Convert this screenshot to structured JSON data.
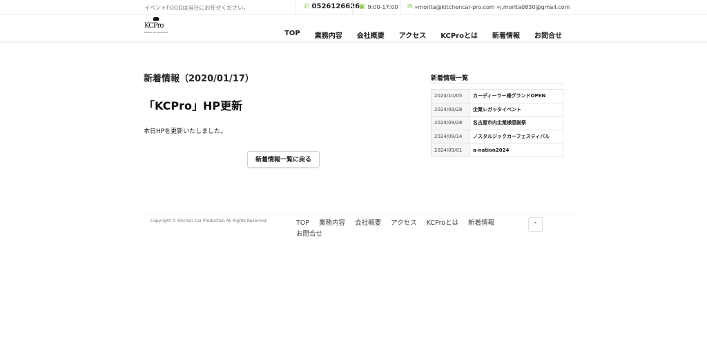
{
  "topbar": {
    "tagline": "イベントFOODは当社にお任せください。",
    "phone": "0526126626",
    "hours": "9:00-17:00",
    "email": "»morita@kitchencar-pro.com »j.morita0830@gmail.com"
  },
  "logo": {
    "main": "KCP",
    "suffix": "ro",
    "sub": "Kitchen Car Production"
  },
  "nav": [
    "TOP",
    "業務内容",
    "会社概要",
    "アクセス",
    "KCProとは",
    "新着情報",
    "お問合せ"
  ],
  "post": {
    "title": "新着情報（2020/01/17）",
    "heading": "「KCPro」HP更新",
    "body": "本日HPを更新いたしました。",
    "back_label": "新着情報一覧に戻る"
  },
  "sidebar": {
    "title": "新着情報一覧",
    "items": [
      {
        "date": "2024/10/05",
        "title": "カーディーラー様グランドOPEN"
      },
      {
        "date": "2024/09/28",
        "title": "企業レガッタイベント"
      },
      {
        "date": "2024/09/28",
        "title": "名古屋市内企業様感謝祭"
      },
      {
        "date": "2024/09/14",
        "title": "ノスタルジックカーフェスティバル"
      },
      {
        "date": "2024/09/01",
        "title": "a-nation2024"
      }
    ]
  },
  "footer": {
    "copyright": "Copyright © Kitchen Car Production All Rights Reserved.",
    "nav": [
      "TOP",
      "業務内容",
      "会社概要",
      "アクセス",
      "KCProとは",
      "新着情報",
      "お問合せ"
    ]
  },
  "icons": {
    "phone": "phone-icon",
    "clock": "calendar-clock-icon",
    "mail": "mail-icon",
    "top": "chevron-up-icon"
  }
}
